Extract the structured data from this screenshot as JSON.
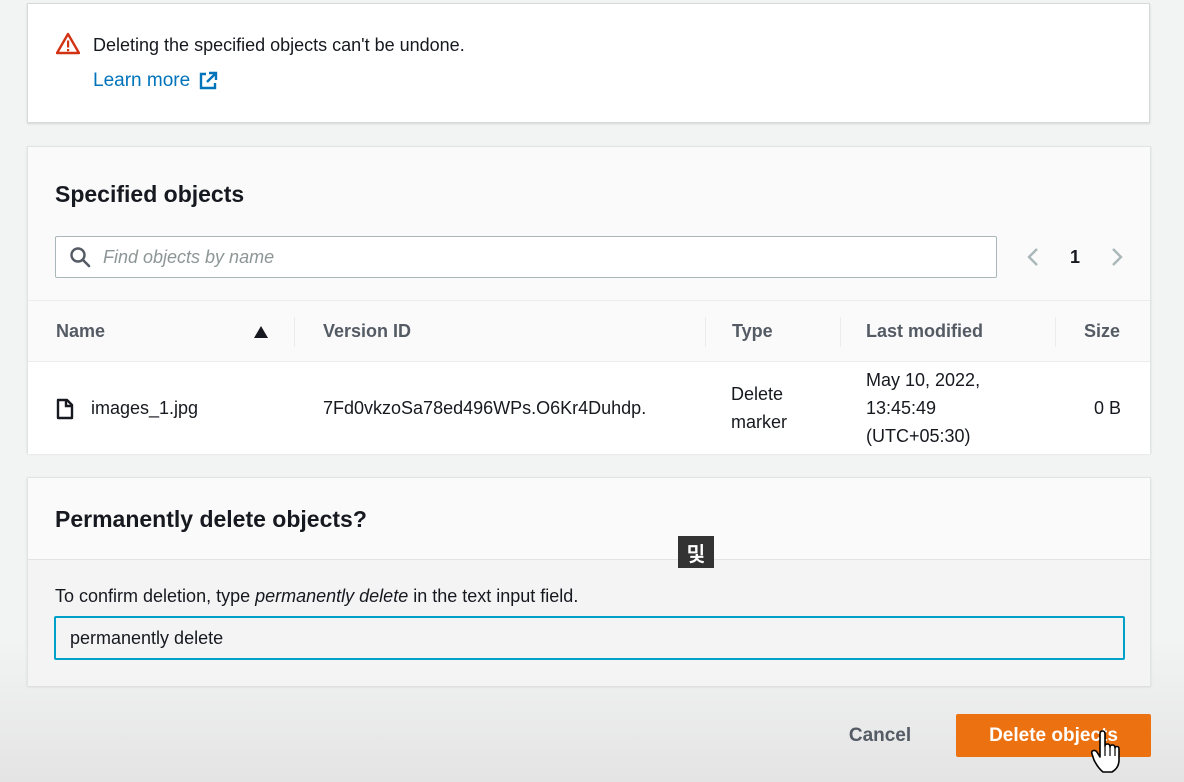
{
  "warning": {
    "message": "Deleting the specified objects can't be undone.",
    "learn_more": "Learn more"
  },
  "objects": {
    "title": "Specified objects",
    "search_placeholder": "Find objects by name",
    "pagination": {
      "current_page": "1"
    },
    "columns": [
      "Name",
      "Version ID",
      "Type",
      "Last modified",
      "Size"
    ],
    "sort": {
      "column": "Name",
      "direction": "ascending"
    },
    "rows": [
      {
        "name": "images_1.jpg",
        "version_id": "7Fd0vkzoSa78ed496WPs.O6Kr4Duhdp.",
        "type_line1": "Delete",
        "type_line2": "marker",
        "modified_line1": "May 10, 2022,",
        "modified_line2": "13:45:49",
        "modified_line3": "(UTC+05:30)",
        "size": "0 B"
      }
    ]
  },
  "confirm": {
    "title": "Permanently delete objects?",
    "label_prefix": "To confirm deletion, type ",
    "label_emphasis": "permanently delete",
    "label_suffix": " in the text input field.",
    "input_value": "permanently delete"
  },
  "ime_indicator": "및",
  "footer": {
    "cancel_label": "Cancel",
    "delete_label": "Delete objects"
  },
  "colors": {
    "primary_button": "#ec7211",
    "link": "#0073bb",
    "warning_icon": "#d13212",
    "focus_border": "#00a1c9"
  }
}
